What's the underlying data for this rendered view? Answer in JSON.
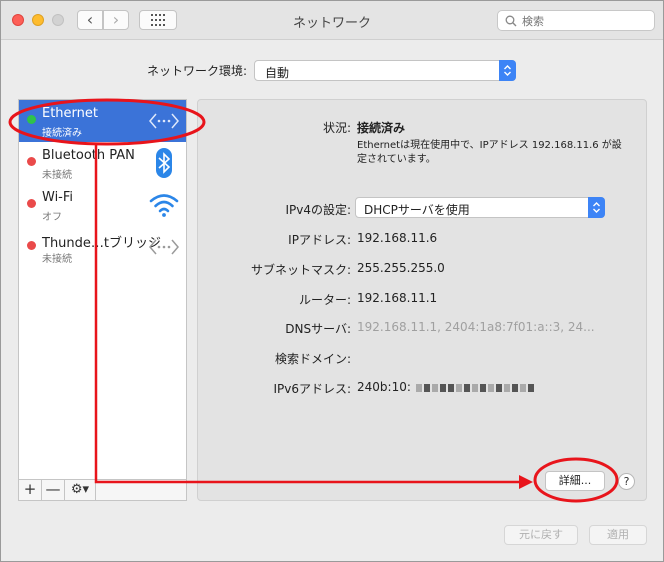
{
  "window": {
    "title": "ネットワーク"
  },
  "search": {
    "placeholder": "検索"
  },
  "location": {
    "label": "ネットワーク環境:",
    "value": "自動"
  },
  "services": [
    {
      "name": "Ethernet",
      "status": "接続済み",
      "status_color": "#2fc24a",
      "icon": "ethernet-icon",
      "selected": true
    },
    {
      "name": "Bluetooth PAN",
      "status": "未接続",
      "status_color": "#ea4a4a",
      "icon": "bluetooth-icon",
      "selected": false
    },
    {
      "name": "Wi-Fi",
      "status": "オフ",
      "status_color": "#ea4a4a",
      "icon": "wifi-icon",
      "selected": false
    },
    {
      "name": "Thunde…tブリッジ",
      "status": "未接続",
      "status_color": "#ea4a4a",
      "icon": "ethernet-icon",
      "selected": false
    }
  ],
  "sidebar_controls": {
    "add": "+",
    "remove": "—",
    "gear": "⚙︎▾"
  },
  "detail": {
    "status_label": "状況:",
    "status_value": "接続済み",
    "status_description": "Ethernetは現在使用中で、IPアドレス 192.168.11.6 が設定されています。",
    "ipv4_label": "IPv4の設定:",
    "ipv4_value": "DHCPサーバを使用",
    "ip_label": "IPアドレス:",
    "ip_value": "192.168.11.6",
    "subnet_label": "サブネットマスク:",
    "subnet_value": "255.255.255.0",
    "router_label": "ルーター:",
    "router_value": "192.168.11.1",
    "dns_label": "DNSサーバ:",
    "dns_value": "192.168.11.1, 2404:1a8:7f01:a::3, 24...",
    "domain_label": "検索ドメイン:",
    "domain_value": "",
    "ipv6_label": "IPv6アドレス:",
    "ipv6_value": "240b:10:"
  },
  "buttons": {
    "advanced": "詳細...",
    "help": "?",
    "revert": "元に戻す",
    "apply": "適用"
  },
  "colors": {
    "accent": "#3b73d8",
    "annotation": "#e8141b"
  }
}
